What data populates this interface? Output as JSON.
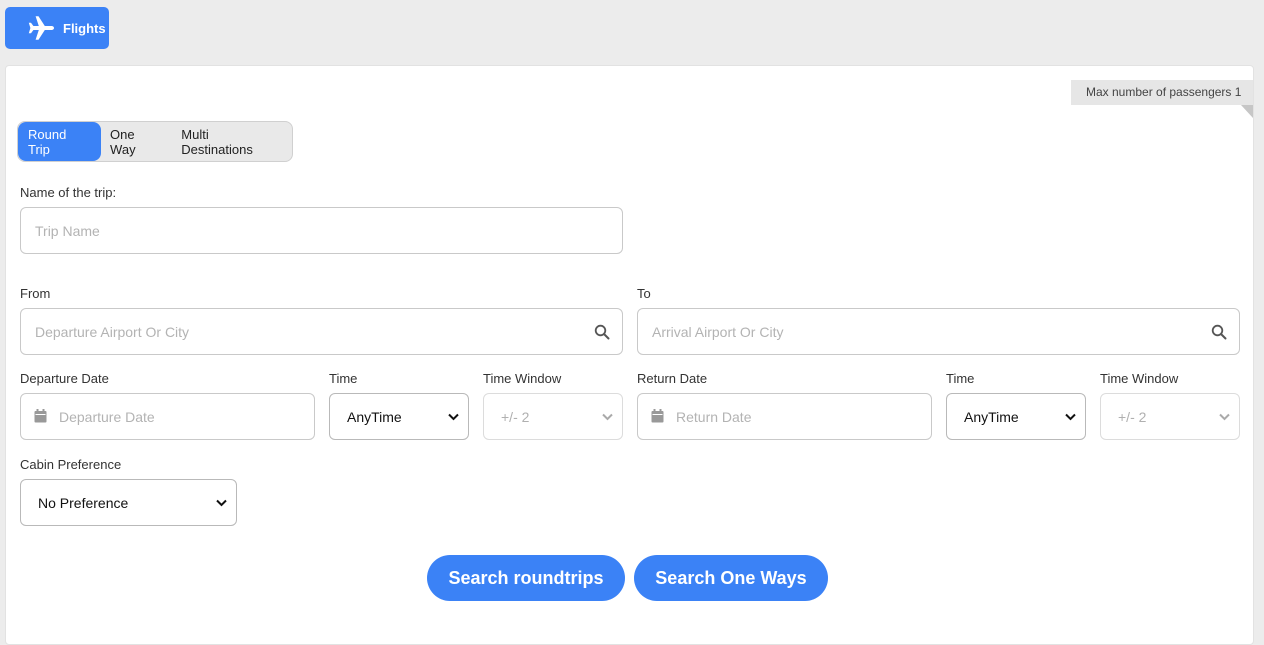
{
  "tabs": {
    "flights_label": "Flights"
  },
  "passengers_badge": "Max number of passengers 1",
  "trip_type": {
    "options": [
      "Round Trip",
      "One Way",
      "Multi Destinations"
    ],
    "selected": "Round Trip"
  },
  "trip_name": {
    "label": "Name of the trip:",
    "placeholder": "Trip Name"
  },
  "from": {
    "label": "From",
    "placeholder": "Departure Airport Or City"
  },
  "to": {
    "label": "To",
    "placeholder": "Arrival Airport Or City"
  },
  "departure": {
    "date_label": "Departure Date",
    "date_placeholder": "Departure Date",
    "time_label": "Time",
    "time_value": "AnyTime",
    "window_label": "Time Window",
    "window_value": "+/- 2"
  },
  "return": {
    "date_label": "Return Date",
    "date_placeholder": "Return Date",
    "time_label": "Time",
    "time_value": "AnyTime",
    "window_label": "Time Window",
    "window_value": "+/- 2"
  },
  "cabin": {
    "label": "Cabin Preference",
    "value": "No Preference"
  },
  "buttons": {
    "search_roundtrips": "Search roundtrips",
    "search_one_ways": "Search One Ways"
  },
  "colors": {
    "accent": "#3b82f6",
    "page_bg": "#ececec"
  },
  "icons": [
    "plane-icon",
    "search-icon",
    "calendar-icon",
    "chevron-down-icon"
  ]
}
